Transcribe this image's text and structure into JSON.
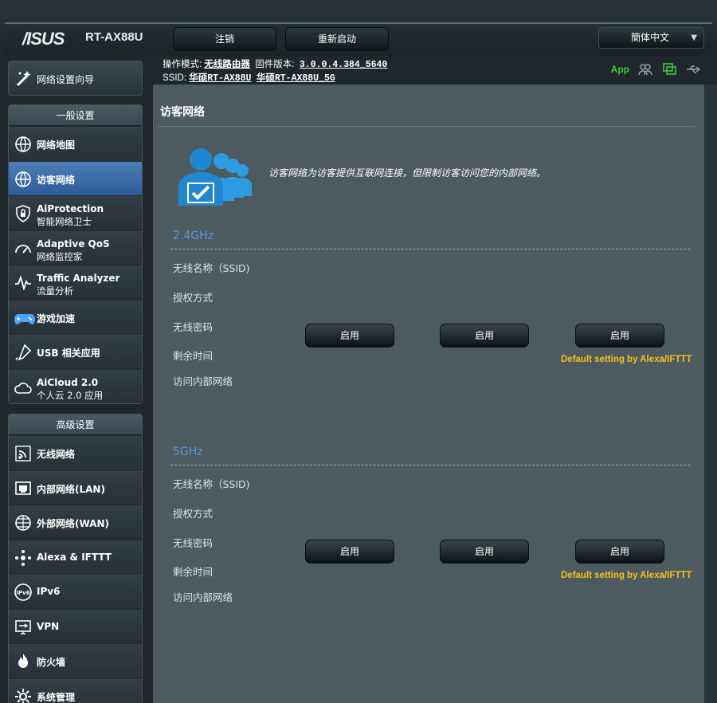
{
  "header": {
    "logo": "/ISUS",
    "model": "RT-AX88U",
    "logout_label": "注销",
    "reboot_label": "重新启动",
    "language": "簡体中文"
  },
  "status": {
    "mode_label": "操作模式:",
    "mode_value": "无线路由器",
    "firmware_label": "固件版本:",
    "firmware_value": "3.0.0.4.384_5640",
    "ssid_label": "SSID:",
    "ssid_24": "华硕RT-AX88U",
    "ssid_5": "华硕RT-AX88U_5G",
    "app_label": "App"
  },
  "sidebar": {
    "wizard_label": "网络设置向导",
    "general_header": "一般设置",
    "general_items": [
      {
        "label": "网络地图",
        "sub": ""
      },
      {
        "label": "访客网络",
        "sub": ""
      },
      {
        "label": "AiProtection",
        "sub": "智能网络卫士"
      },
      {
        "label": "Adaptive QoS",
        "sub": "网络监控家"
      },
      {
        "label": "Traffic Analyzer",
        "sub": "流量分析"
      },
      {
        "label": "游戏加速",
        "sub": ""
      },
      {
        "label": "USB 相关应用",
        "sub": ""
      },
      {
        "label": "AiCloud 2.0",
        "sub": "个人云 2.0 应用"
      }
    ],
    "advanced_header": "高级设置",
    "advanced_items": [
      {
        "label": "无线网络"
      },
      {
        "label": "内部网络(LAN)"
      },
      {
        "label": "外部网络(WAN)"
      },
      {
        "label": "Alexa & IFTTT"
      },
      {
        "label": "IPv6"
      },
      {
        "label": "VPN"
      },
      {
        "label": "防火墙"
      },
      {
        "label": "系统管理"
      }
    ]
  },
  "main": {
    "title": "访客网络",
    "description": "访客网络为访客提供互联网连接，但限制访客访问您的内部网络。",
    "fields": [
      "无线名称（SSID)",
      "授权方式",
      "无线密码",
      "剩余时间",
      "访问内部网络"
    ],
    "bands": [
      {
        "name": "2.4GHz",
        "buttons": [
          "启用",
          "启用",
          "启用"
        ],
        "note": "Default setting by Alexa/IFTTT"
      },
      {
        "name": "5GHz",
        "buttons": [
          "启用",
          "启用",
          "启用"
        ],
        "note": "Default setting by Alexa/IFTTT"
      }
    ]
  },
  "colors": {
    "accent_blue": "#569ad6",
    "note_yellow": "#f4c01c",
    "active_item": "#3d6fa8",
    "app_green": "#3cc83c"
  }
}
